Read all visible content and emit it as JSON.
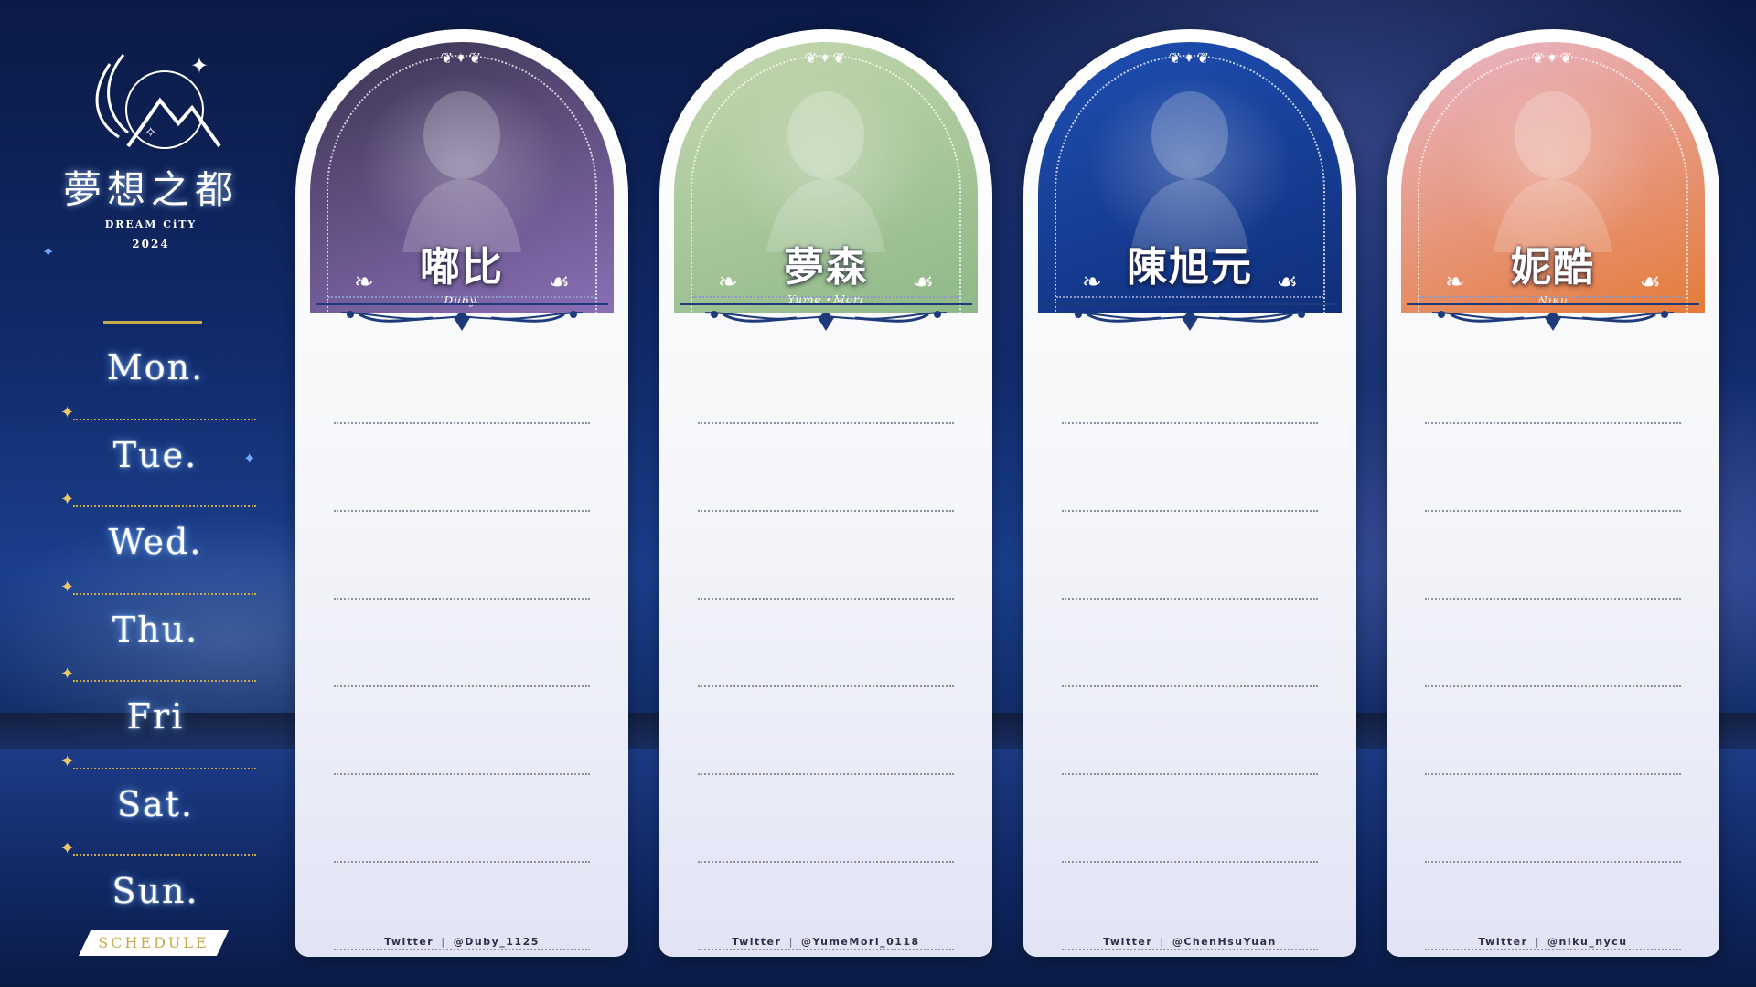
{
  "logo": {
    "title": "夢想之都",
    "subtitle": "DREAM CiTY",
    "year": "2024"
  },
  "days": [
    "Mon.",
    "Tue.",
    "Wed.",
    "Thu.",
    "Fri",
    "Sat.",
    "Sun."
  ],
  "schedule_label": "SCHEDULE",
  "cards": [
    {
      "name": "嘟比",
      "sub_name": "Duby.",
      "twitter_label": "Twitter",
      "twitter_separator": "|",
      "twitter_handle": "@Duby_1125",
      "theme_color": "#3a3350",
      "accent_color": "#8a6fb5"
    },
    {
      "name": "夢森",
      "sub_name": "Yume・Mori",
      "twitter_label": "Twitter",
      "twitter_separator": "|",
      "twitter_handle": "@YumeMori_0118",
      "theme_color": "#c5d8b0",
      "accent_color": "#8fb888"
    },
    {
      "name": "陳旭元",
      "sub_name": "",
      "twitter_label": "Twitter",
      "twitter_separator": "|",
      "twitter_handle": "@ChenHsuYuan",
      "theme_color": "#1f4fb3",
      "accent_color": "#0f2f7a"
    },
    {
      "name": "妮酷",
      "sub_name": "Niku",
      "twitter_label": "Twitter",
      "twitter_separator": "|",
      "twitter_handle": "@niku_nycu",
      "theme_color": "#e9b7c8",
      "accent_color": "#e57b3a"
    }
  ]
}
